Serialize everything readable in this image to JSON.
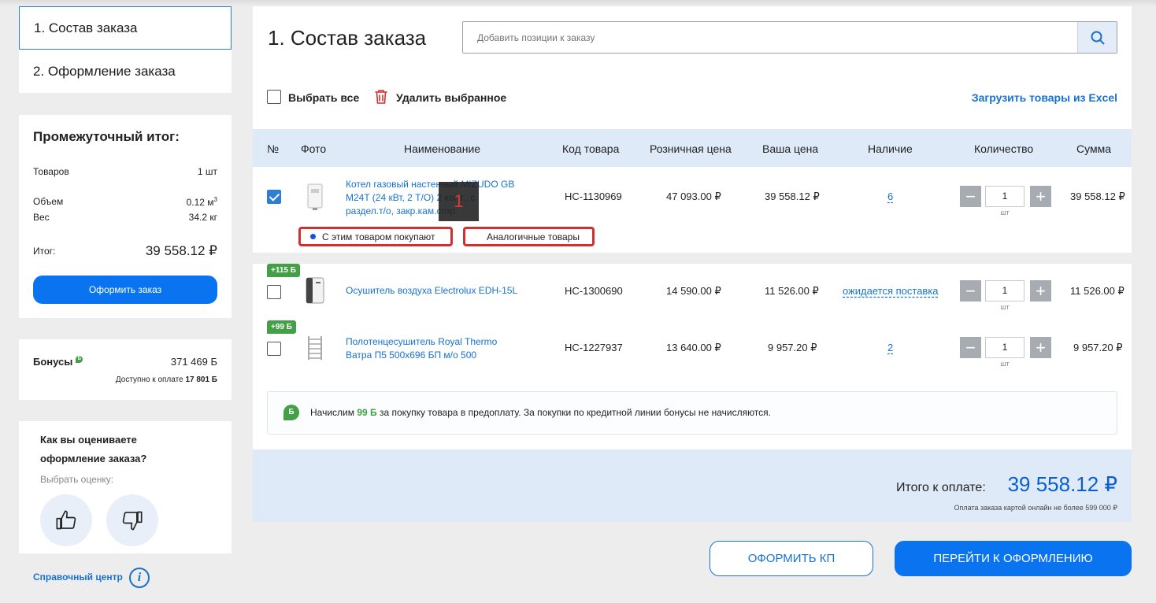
{
  "steps": [
    {
      "label": "1. Состав заказа"
    },
    {
      "label": "2. Оформление заказа"
    }
  ],
  "summary": {
    "title": "Промежуточный итог:",
    "items_label": "Товаров",
    "items_value": "1 шт",
    "volume_label": "Объем",
    "volume_value": "0.12 м",
    "volume_sup": "3",
    "weight_label": "Вес",
    "weight_value": "34.2 кг",
    "total_label": "Итог:",
    "total_value": "39 558.12 ₽",
    "checkout_label": "Оформить заказ"
  },
  "bonuses": {
    "label": "Бонусы",
    "badge": "Б",
    "value": "371 469 Б",
    "available_label": "Доступно к оплате",
    "available_value": "17 801 Б"
  },
  "rating": {
    "question_line1": "Как вы оцениваете",
    "question_line2": "оформление заказа?",
    "prompt": "Выбрать оценку:",
    "like_icon": "thumbs-up-icon",
    "dislike_icon": "thumbs-down-icon"
  },
  "help": {
    "label": "Справочный центр",
    "icon": "info-icon"
  },
  "main": {
    "title": "1. Состав заказа",
    "search_placeholder": "Добавить позиции к заказу",
    "select_all": "Выбрать все",
    "delete_selected": "Удалить выбранное",
    "upload_excel": "Загрузить товары из Excel"
  },
  "table": {
    "headers": {
      "num": "№",
      "photo": "Фото",
      "name": "Наименование",
      "code": "Код товара",
      "retail": "Розничная цена",
      "your_price": "Ваша цена",
      "stock": "Наличие",
      "qty": "Количество",
      "sum": "Сумма"
    },
    "rows": [
      {
        "checked": true,
        "name_line1": "Котел газовый настенный MIZUDO GB",
        "name_line2": "M24T (24 кВт, 2 Т/О) 2 конт., с",
        "name_line3": "раздел.т/о, закр.кам.сгор.",
        "code": "НС-1130969",
        "retail": "47 093.00 ₽",
        "price": "39 558.12 ₽",
        "stock": "6",
        "qty": "1",
        "unit": "шт",
        "sum": "39 558.12 ₽",
        "tab_bought": "С этим товаром покупают",
        "tab_similar": "Аналогичные товары"
      },
      {
        "checked": false,
        "bonus": "+115 Б",
        "name_line1": "Осушитель воздуха Electrolux EDH-15L",
        "code": "НС-1300690",
        "retail": "14 590.00 ₽",
        "price": "11 526.00 ₽",
        "stock": "ожидается поставка",
        "qty": "1",
        "unit": "шт",
        "sum": "11 526.00 ₽"
      },
      {
        "checked": false,
        "bonus": "+99 Б",
        "name_line1": "Полотенцесушитель Royal Thermo",
        "name_line2": "Ватра П5 500x696 БП м/о 500",
        "code": "НС-1227937",
        "retail": "13 640.00 ₽",
        "price": "9 957.20 ₽",
        "stock": "2",
        "qty": "1",
        "unit": "шт",
        "sum": "9 957.20 ₽"
      }
    ]
  },
  "tooltip_number": "1",
  "bonus_note": {
    "badge": "Б",
    "prefix": "Начислим",
    "amount": "99 Б",
    "suffix": "за покупку товара в предоплату. За покупки по кредитной линии бонусы не начисляются."
  },
  "total": {
    "label": "Итого к оплате:",
    "value": "39 558.12 ₽",
    "note": "Оплата заказа картой онлайн не более 599 000 ₽"
  },
  "actions": {
    "kp": "ОФОРМИТЬ КП",
    "checkout": "ПЕРЕЙТИ К ОФОРМЛЕНИЮ"
  },
  "colors": {
    "accent": "#0a74f0",
    "bonus": "#43a047",
    "header_bg": "#dfeaf8",
    "highlight": "#d32f2f"
  }
}
